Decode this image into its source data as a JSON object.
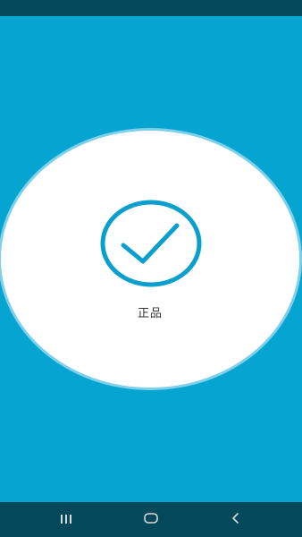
{
  "result": {
    "label": "正品"
  },
  "colors": {
    "background": "#06a4d1",
    "bars": "#04495b",
    "oval": "#ffffff",
    "oval_border": "#7fd0ea",
    "check": "#0a9fcc"
  },
  "icons": {
    "check": "check-circle-icon",
    "recents": "recents-icon",
    "home": "home-icon",
    "back": "back-icon"
  }
}
